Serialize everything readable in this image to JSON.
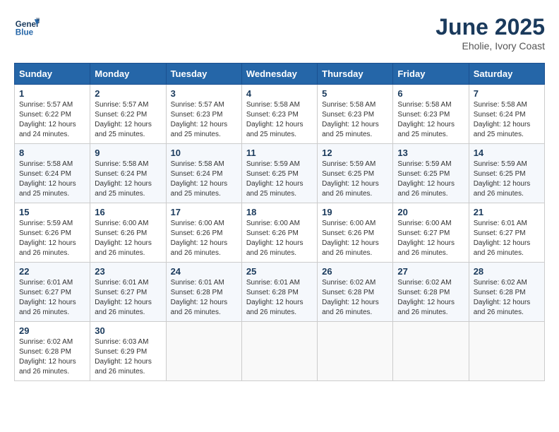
{
  "header": {
    "logo_line1": "General",
    "logo_line2": "Blue",
    "month": "June 2025",
    "location": "Eholie, Ivory Coast"
  },
  "weekdays": [
    "Sunday",
    "Monday",
    "Tuesday",
    "Wednesday",
    "Thursday",
    "Friday",
    "Saturday"
  ],
  "weeks": [
    [
      {
        "day": "1",
        "info": "Sunrise: 5:57 AM\nSunset: 6:22 PM\nDaylight: 12 hours\nand 24 minutes."
      },
      {
        "day": "2",
        "info": "Sunrise: 5:57 AM\nSunset: 6:22 PM\nDaylight: 12 hours\nand 25 minutes."
      },
      {
        "day": "3",
        "info": "Sunrise: 5:57 AM\nSunset: 6:23 PM\nDaylight: 12 hours\nand 25 minutes."
      },
      {
        "day": "4",
        "info": "Sunrise: 5:58 AM\nSunset: 6:23 PM\nDaylight: 12 hours\nand 25 minutes."
      },
      {
        "day": "5",
        "info": "Sunrise: 5:58 AM\nSunset: 6:23 PM\nDaylight: 12 hours\nand 25 minutes."
      },
      {
        "day": "6",
        "info": "Sunrise: 5:58 AM\nSunset: 6:23 PM\nDaylight: 12 hours\nand 25 minutes."
      },
      {
        "day": "7",
        "info": "Sunrise: 5:58 AM\nSunset: 6:24 PM\nDaylight: 12 hours\nand 25 minutes."
      }
    ],
    [
      {
        "day": "8",
        "info": "Sunrise: 5:58 AM\nSunset: 6:24 PM\nDaylight: 12 hours\nand 25 minutes."
      },
      {
        "day": "9",
        "info": "Sunrise: 5:58 AM\nSunset: 6:24 PM\nDaylight: 12 hours\nand 25 minutes."
      },
      {
        "day": "10",
        "info": "Sunrise: 5:58 AM\nSunset: 6:24 PM\nDaylight: 12 hours\nand 25 minutes."
      },
      {
        "day": "11",
        "info": "Sunrise: 5:59 AM\nSunset: 6:25 PM\nDaylight: 12 hours\nand 25 minutes."
      },
      {
        "day": "12",
        "info": "Sunrise: 5:59 AM\nSunset: 6:25 PM\nDaylight: 12 hours\nand 26 minutes."
      },
      {
        "day": "13",
        "info": "Sunrise: 5:59 AM\nSunset: 6:25 PM\nDaylight: 12 hours\nand 26 minutes."
      },
      {
        "day": "14",
        "info": "Sunrise: 5:59 AM\nSunset: 6:25 PM\nDaylight: 12 hours\nand 26 minutes."
      }
    ],
    [
      {
        "day": "15",
        "info": "Sunrise: 5:59 AM\nSunset: 6:26 PM\nDaylight: 12 hours\nand 26 minutes."
      },
      {
        "day": "16",
        "info": "Sunrise: 6:00 AM\nSunset: 6:26 PM\nDaylight: 12 hours\nand 26 minutes."
      },
      {
        "day": "17",
        "info": "Sunrise: 6:00 AM\nSunset: 6:26 PM\nDaylight: 12 hours\nand 26 minutes."
      },
      {
        "day": "18",
        "info": "Sunrise: 6:00 AM\nSunset: 6:26 PM\nDaylight: 12 hours\nand 26 minutes."
      },
      {
        "day": "19",
        "info": "Sunrise: 6:00 AM\nSunset: 6:26 PM\nDaylight: 12 hours\nand 26 minutes."
      },
      {
        "day": "20",
        "info": "Sunrise: 6:00 AM\nSunset: 6:27 PM\nDaylight: 12 hours\nand 26 minutes."
      },
      {
        "day": "21",
        "info": "Sunrise: 6:01 AM\nSunset: 6:27 PM\nDaylight: 12 hours\nand 26 minutes."
      }
    ],
    [
      {
        "day": "22",
        "info": "Sunrise: 6:01 AM\nSunset: 6:27 PM\nDaylight: 12 hours\nand 26 minutes."
      },
      {
        "day": "23",
        "info": "Sunrise: 6:01 AM\nSunset: 6:27 PM\nDaylight: 12 hours\nand 26 minutes."
      },
      {
        "day": "24",
        "info": "Sunrise: 6:01 AM\nSunset: 6:28 PM\nDaylight: 12 hours\nand 26 minutes."
      },
      {
        "day": "25",
        "info": "Sunrise: 6:01 AM\nSunset: 6:28 PM\nDaylight: 12 hours\nand 26 minutes."
      },
      {
        "day": "26",
        "info": "Sunrise: 6:02 AM\nSunset: 6:28 PM\nDaylight: 12 hours\nand 26 minutes."
      },
      {
        "day": "27",
        "info": "Sunrise: 6:02 AM\nSunset: 6:28 PM\nDaylight: 12 hours\nand 26 minutes."
      },
      {
        "day": "28",
        "info": "Sunrise: 6:02 AM\nSunset: 6:28 PM\nDaylight: 12 hours\nand 26 minutes."
      }
    ],
    [
      {
        "day": "29",
        "info": "Sunrise: 6:02 AM\nSunset: 6:28 PM\nDaylight: 12 hours\nand 26 minutes."
      },
      {
        "day": "30",
        "info": "Sunrise: 6:03 AM\nSunset: 6:29 PM\nDaylight: 12 hours\nand 26 minutes."
      },
      null,
      null,
      null,
      null,
      null
    ]
  ]
}
